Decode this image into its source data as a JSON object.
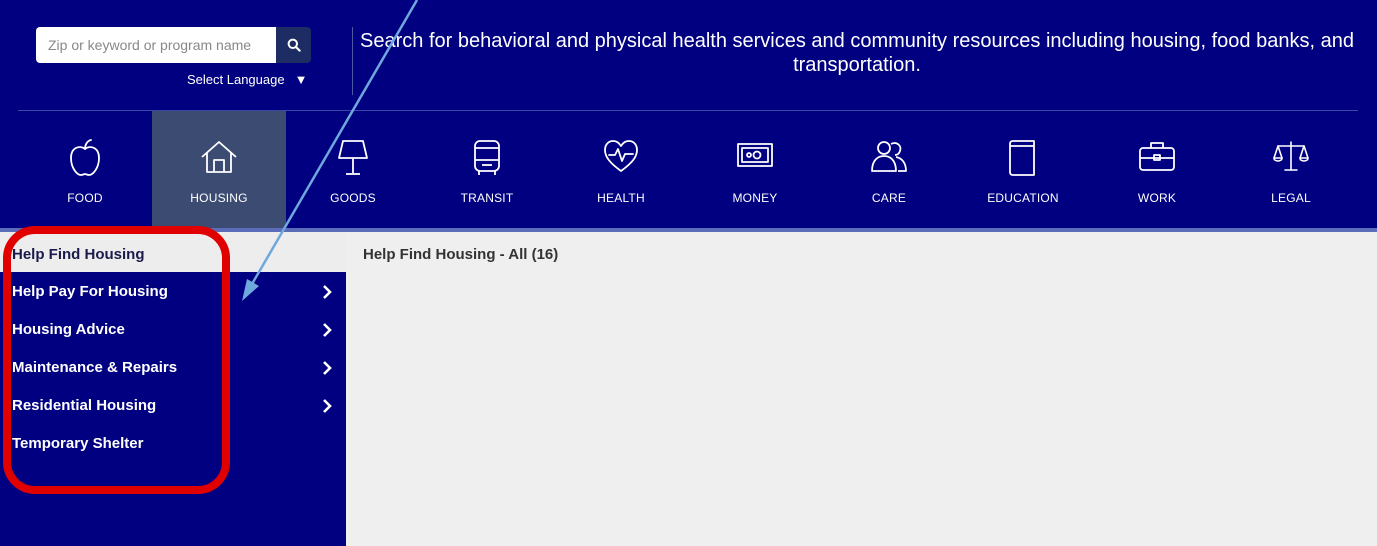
{
  "search": {
    "placeholder": "Zip or keyword or program name"
  },
  "language": {
    "label": "Select Language",
    "caret": "▼"
  },
  "tagline": "Search for behavioral and physical health services and community resources including housing, food banks, and transportation.",
  "categories": [
    {
      "label": "FOOD",
      "icon": "apple-icon"
    },
    {
      "label": "HOUSING",
      "icon": "house-icon",
      "active": true
    },
    {
      "label": "GOODS",
      "icon": "lamp-icon"
    },
    {
      "label": "TRANSIT",
      "icon": "bus-icon"
    },
    {
      "label": "HEALTH",
      "icon": "heart-pulse-icon"
    },
    {
      "label": "MONEY",
      "icon": "money-icon"
    },
    {
      "label": "CARE",
      "icon": "people-icon"
    },
    {
      "label": "EDUCATION",
      "icon": "book-icon"
    },
    {
      "label": "WORK",
      "icon": "briefcase-icon"
    },
    {
      "label": "LEGAL",
      "icon": "scales-icon"
    }
  ],
  "sidebar": {
    "heading": "Help Find Housing",
    "items": [
      {
        "label": "Help Pay For Housing",
        "has_submenu": true
      },
      {
        "label": "Housing Advice",
        "has_submenu": true
      },
      {
        "label": "Maintenance & Repairs",
        "has_submenu": true
      },
      {
        "label": "Residential Housing",
        "has_submenu": true
      },
      {
        "label": "Temporary Shelter",
        "has_submenu": false
      }
    ]
  },
  "main": {
    "title": "Help Find Housing - All (16)"
  },
  "colors": {
    "header_bg": "#000080",
    "active_tab": "#3c4b72",
    "main_bg": "#efefef",
    "highlight": "#e00000",
    "annotation_arrow": "#6fa8dc"
  }
}
